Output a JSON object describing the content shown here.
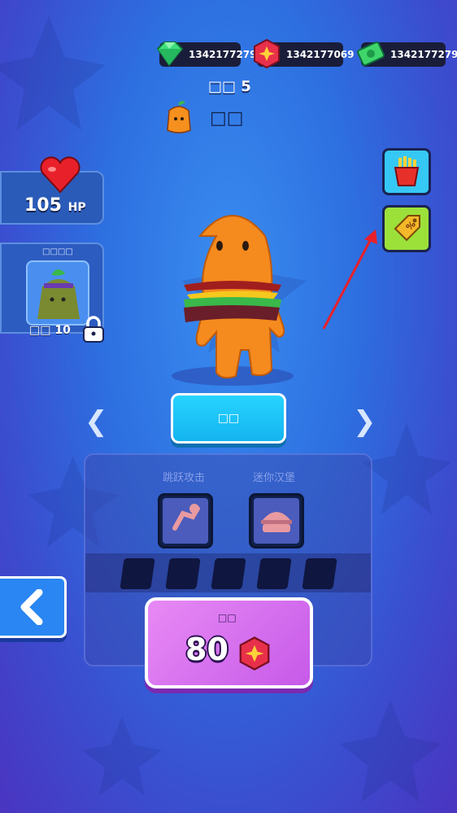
{
  "currencies": {
    "gems": "1342177279",
    "coins": "1342177069",
    "cash": "1342177279"
  },
  "level": {
    "label": "□□",
    "value": "5"
  },
  "character_tag": "□□",
  "stats": {
    "hp_value": "105",
    "hp_unit": "HP"
  },
  "locked_character": {
    "title": "□□□□",
    "level_label": "□□",
    "level_value": "10"
  },
  "select_button": "□□",
  "skills": [
    {
      "name": "跳跃攻击",
      "icon": "jump-attack-icon"
    },
    {
      "name": "迷你汉堡",
      "icon": "mini-burger-icon"
    }
  ],
  "buy": {
    "label": "□□",
    "price": "80"
  },
  "side_buttons": [
    "fries-shop-icon",
    "discount-tag-icon"
  ],
  "colors": {
    "accent_cyan": "#14b4f0",
    "buy_purple": "#c65ae8",
    "heart_red": "#e8202a"
  }
}
